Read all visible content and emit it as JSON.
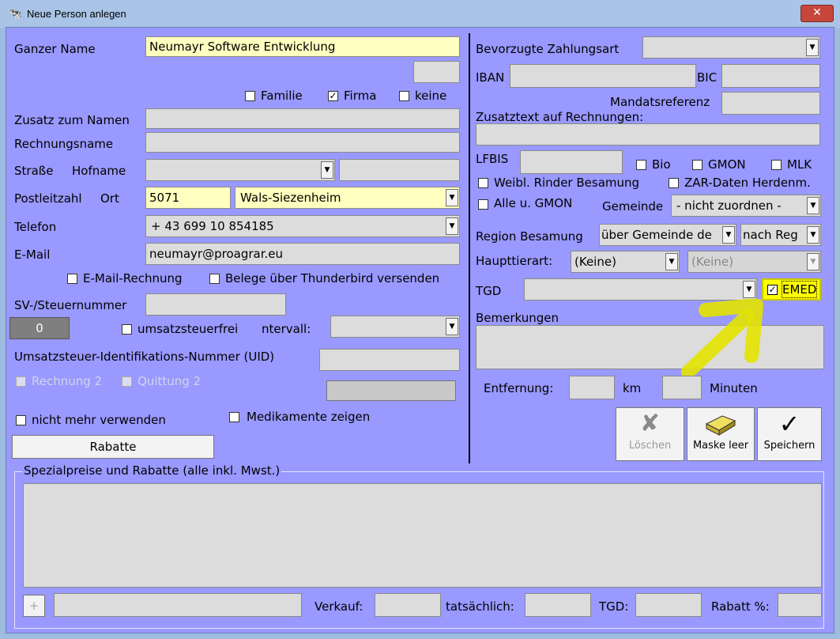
{
  "window": {
    "title": "Neue Person anlegen",
    "close": "✕"
  },
  "left": {
    "ganzer_name_label": "Ganzer Name",
    "ganzer_name_value": "Neumayr Software Entwicklung",
    "familie": "Familie",
    "firma": "Firma",
    "keine": "keine",
    "zusatz_label": "Zusatz zum Namen",
    "rechnungsname_label": "Rechnungsname",
    "strasse_label": "Straße",
    "hofname_label": "Hofname",
    "plz_label": "Postleitzahl",
    "ort_label": "Ort",
    "plz_value": "5071",
    "ort_value": "Wals-Siezenheim",
    "telefon_label": "Telefon",
    "telefon_value": "+ 43 699 10 854185",
    "email_label": "E-Mail",
    "email_value": "neumayr@proagrar.eu",
    "email_rechnung": "E-Mail-Rechnung",
    "thunderbird": "Belege über Thunderbird versenden",
    "sv_label": "SV-/Steuernummer",
    "counter_value": "0",
    "umsatzsteuerfrei": "umsatzsteuerfrei",
    "intervall_label": "ntervall:",
    "uid_label": "Umsatzsteuer-Identifikations-Nummer (UID)",
    "rechnung2": "Rechnung 2",
    "quittung2": "Quittung 2",
    "nicht_mehr": "nicht mehr verwenden",
    "medikamente": "Medikamente zeigen",
    "rabatte_btn": "Rabatte"
  },
  "right": {
    "zahlungsart_label": "Bevorzugte Zahlungsart",
    "iban_label": "IBAN",
    "bic_label": "BIC",
    "mandats_label": "Mandatsreferenz",
    "zusatztext_label": "Zusatztext auf Rechnungen:",
    "lfbis_label": "LFBIS",
    "bio": "Bio",
    "gmon": "GMON",
    "mlk": "MLK",
    "weibl": "Weibl. Rinder Besamung",
    "zar": "ZAR-Daten Herdenm.",
    "alle": "Alle u. GMON",
    "gemeinde_label": "Gemeinde",
    "gemeinde_value": "- nicht zuordnen -",
    "region_label": "Region Besamung",
    "region_value1": "über Gemeinde de",
    "region_value2": "nach Reg",
    "haupttierart_label": "Haupttierart:",
    "haupttierart_value": "(Keine)",
    "haupttierart_value2": "(Keine)",
    "tgd_label": "TGD",
    "emed": "EMED",
    "bemerkungen_label": "Bemerkungen",
    "entfernung_label": "Entfernung:",
    "km_label": "km",
    "minuten_label": "Minuten",
    "loeschen": "Löschen",
    "maske_leer": "Maske leer",
    "speichern": "Speichern"
  },
  "bottom": {
    "group_title": "Spezialpreise und Rabatte (alle inkl. Mwst.)",
    "plus": "+",
    "verkauf_label": "Verkauf:",
    "tatsaechlich_label": "tatsächlich:",
    "tgd_label": "TGD:",
    "rabatt_label": "Rabatt %:"
  },
  "colors": {
    "form_bg": "#9999ff",
    "highlight": "#ffffc0",
    "annotation": "#e6e600"
  }
}
